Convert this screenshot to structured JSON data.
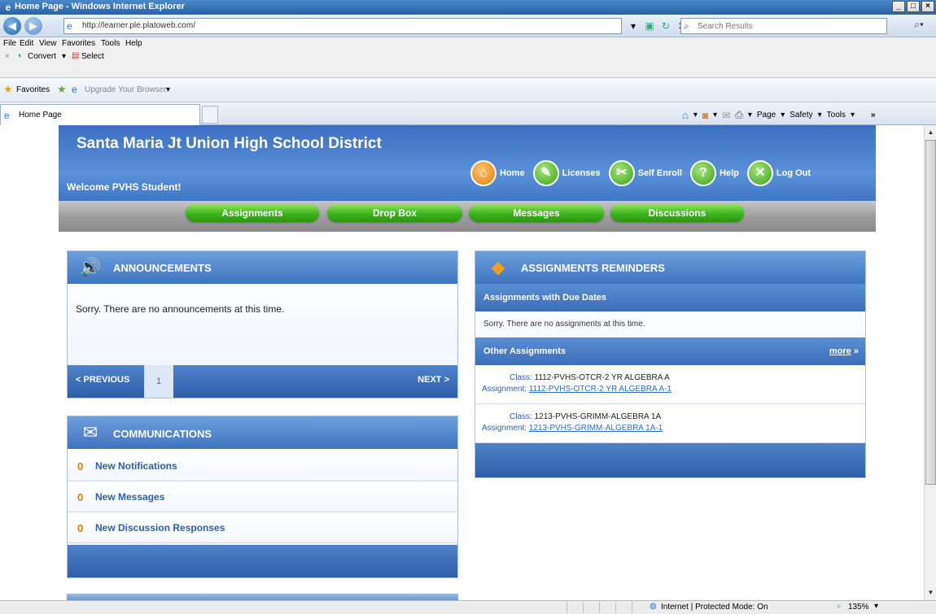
{
  "browser": {
    "title": "Home Page - Windows Internet Explorer",
    "url": "http://learner.ple.platoweb.com/",
    "search_placeholder": "Search Results",
    "menu": [
      "File",
      "Edit",
      "View",
      "Favorites",
      "Tools",
      "Help"
    ],
    "cmd": {
      "convert": "Convert",
      "select": "Select"
    },
    "favorites": {
      "label": "Favorites",
      "upgrade": "Upgrade Your Browser"
    },
    "tab": {
      "label": "Home Page"
    },
    "toolbar": {
      "page": "Page",
      "safety": "Safety",
      "tools": "Tools"
    },
    "status": {
      "zone": "Internet | Protected Mode: On",
      "zoom": "135%"
    }
  },
  "site": {
    "title": "Santa Maria Jt Union High School District",
    "welcome": "Welcome PVHS Student!",
    "toplinks": {
      "home": "Home",
      "licenses": "Licenses",
      "self_enroll": "Self Enroll",
      "help": "Help",
      "logout": "Log Out"
    },
    "nav": {
      "assignments": "Assignments",
      "dropbox": "Drop Box",
      "messages": "Messages",
      "discussions": "Discussions"
    }
  },
  "announcements": {
    "title": "ANNOUNCEMENTS",
    "message": "Sorry. There are no announcements at this time.",
    "prev": "< PREVIOUS",
    "page": "1",
    "next": "NEXT >"
  },
  "communications": {
    "title": "COMMUNICATIONS",
    "rows": [
      {
        "count": "0",
        "label": "New Notifications"
      },
      {
        "count": "0",
        "label": "New Messages"
      },
      {
        "count": "0",
        "label": "New Discussion Responses"
      }
    ]
  },
  "reminders": {
    "title": "ASSIGNMENTS REMINDERS",
    "due_header": "Assignments with Due Dates",
    "no_assignments": "Sorry. There are no assignments at this time.",
    "other_header": "Other Assignments",
    "more": "more",
    "class_label": "Class:",
    "assignment_label": "Assignment:",
    "items": [
      {
        "class": "1112-PVHS-OTCR-2 YR ALGEBRA A",
        "assignment": "1112-PVHS-OTCR-2 YR ALGEBRA A-1"
      },
      {
        "class": "1213-PVHS-GRIMM-ALGEBRA 1A",
        "assignment": "1213-PVHS-GRIMM-ALGEBRA 1A-1"
      }
    ]
  },
  "colors": {
    "header_blue": "#3f78c8",
    "nav_green": "#3cb21c",
    "count_orange": "#e07a12"
  }
}
